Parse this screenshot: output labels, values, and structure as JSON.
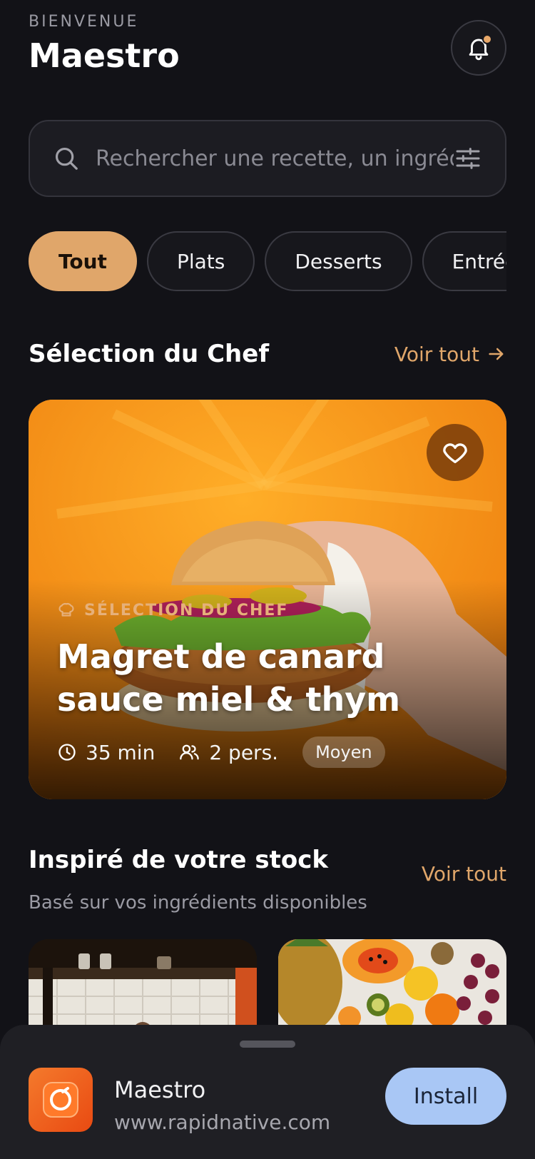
{
  "header": {
    "welcome": "BIENVENUE",
    "title": "Maestro",
    "bell_icon": "bell-icon"
  },
  "search": {
    "placeholder": "Rechercher une recette, un ingrédient",
    "value": "",
    "icon": "search-icon",
    "filter_icon": "sliders-icon"
  },
  "filters": [
    {
      "label": "Tout",
      "active": true
    },
    {
      "label": "Plats",
      "active": false
    },
    {
      "label": "Desserts",
      "active": false
    },
    {
      "label": "Entrées",
      "active": false
    }
  ],
  "chef_section": {
    "title": "Sélection du Chef",
    "see_all": "Voir tout",
    "featured": {
      "tag": "SÉLECTION DU CHEF",
      "title": "Magret de canard sauce miel & thym",
      "time": "35 min",
      "servings": "2 pers.",
      "difficulty": "Moyen",
      "favorite_icon": "heart-icon"
    }
  },
  "stock_section": {
    "title": "Inspiré de votre stock",
    "subtitle": "Basé sur vos ingrédients disponibles",
    "see_all": "Voir tout"
  },
  "install_banner": {
    "app_name": "Maestro",
    "url": "www.rapidnative.com",
    "install_label": "Install"
  },
  "colors": {
    "accent": "#e0a66a",
    "background": "#121217",
    "install": "#a9c7f5"
  }
}
